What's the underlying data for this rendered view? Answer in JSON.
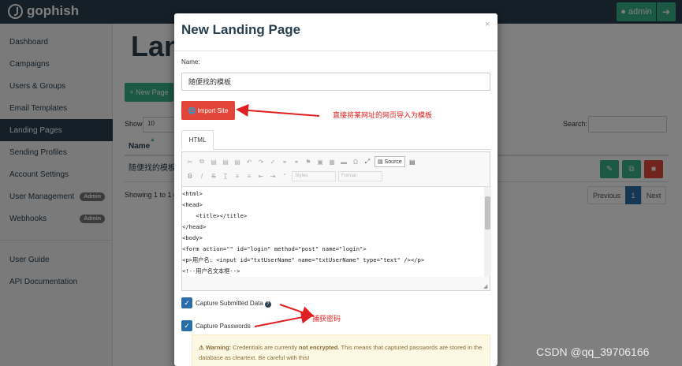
{
  "topbar": {
    "brand": "gophish",
    "admin_label": "admin",
    "admin_icon": "user-icon",
    "logout_icon": "sign-out-icon"
  },
  "sidebar": {
    "items": [
      {
        "label": "Dashboard"
      },
      {
        "label": "Campaigns"
      },
      {
        "label": "Users & Groups"
      },
      {
        "label": "Email Templates"
      },
      {
        "label": "Landing Pages",
        "active": true
      },
      {
        "label": "Sending Profiles"
      },
      {
        "label": "Account Settings"
      },
      {
        "label": "User Management",
        "badge": "Admin"
      },
      {
        "label": "Webhooks",
        "badge": "Admin"
      },
      {
        "label": "User Guide"
      },
      {
        "label": "API Documentation"
      }
    ]
  },
  "main": {
    "title": "Lan",
    "new_page_label": "+ New Page",
    "show_label": "Show",
    "show_value": "10",
    "search_label": "Search:",
    "column_name": "Name",
    "rows": [
      {
        "name": "随便找的模板"
      }
    ],
    "showing_text": "Showing 1 to 1 of",
    "pagination": {
      "previous": "Previous",
      "current": "1",
      "next": "Next"
    }
  },
  "modal": {
    "title": "New Landing Page",
    "close": "×",
    "name_label": "Name:",
    "name_value": "随便找的模板",
    "import_label": "Import Site",
    "tab_label": "HTML",
    "toolbar": {
      "source_label": "Source",
      "styles_placeholder": "Styles",
      "format_placeholder": "Format"
    },
    "code_lines": [
      "<html>",
      "<head>",
      "    <title></title>",
      "</head>",
      "<body>",
      "<form action=\"\" id=\"login\" method=\"post\" name=\"login\">",
      "<p>用户名: <input id=\"txtUserName\" name=\"txtUserName\" type=\"text\" /></p>",
      "<!--用户名文本框-->"
    ],
    "capture_submitted_label": "Capture Submitted Data",
    "capture_passwords_label": "Capture Passwords",
    "warning_strong": "Warning:",
    "warning_text_a": " Credentials are currently ",
    "warning_bold": "not encrypted",
    "warning_text_b": ". This means that captured passwords are stored in the database as cleartext. Be careful with this!"
  },
  "annotations": {
    "import_note": "直接将某网址的网页导入为模板",
    "capture_note": "捕获密码",
    "color": "#e02020"
  },
  "watermark": "CSDN @qq_39706166",
  "colors": {
    "navy": "#283f50",
    "green": "#37b38b",
    "red": "#e2463b",
    "blue": "#2b6ea7"
  }
}
